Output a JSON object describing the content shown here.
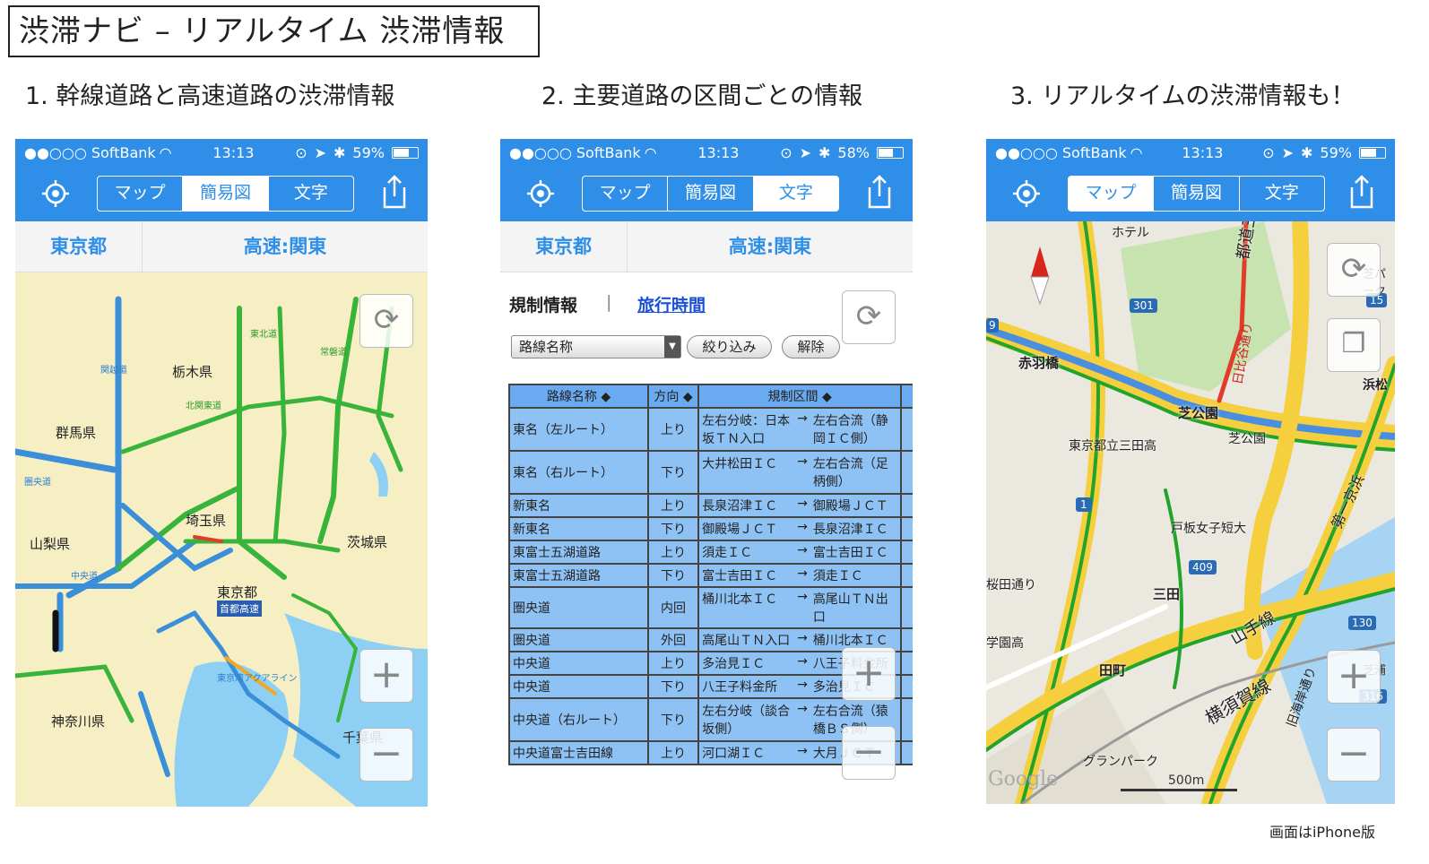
{
  "title": "渋滞ナビ – リアルタイム 渋滞情報",
  "captions": [
    "1. 幹線道路と高速道路の渋滞情報",
    "2. 主要道路の区間ごとの情報",
    "3. リアルタイムの渋滞情報も！"
  ],
  "footer": "画面はiPhone版",
  "colors": {
    "accent": "#2f8fe8",
    "table_cell": "#8fc2f4",
    "jam": "#e23b2b",
    "flow": "#22a42a",
    "slow": "#f5a623"
  },
  "phones": [
    {
      "carrier": "●●○○○ SoftBank",
      "time": "13:13",
      "battery": "59%",
      "selected_tab": "簡易図",
      "battery_level": 0.59
    },
    {
      "carrier": "●●○○○ SoftBank",
      "time": "13:13",
      "battery": "58%",
      "selected_tab": "文字",
      "battery_level": 0.58
    },
    {
      "carrier": "●●○○○ SoftBank",
      "time": "13:13",
      "battery": "59%",
      "selected_tab": "マップ",
      "battery_level": 0.59
    }
  ],
  "tabs": {
    "map": "マップ",
    "simple": "簡易図",
    "text": "文字"
  },
  "region": {
    "area": "東京都",
    "road": "高速:関東"
  },
  "simple_map": {
    "prefectures": [
      "栃木県",
      "群馬県",
      "埼玉県",
      "茨城県",
      "山梨県",
      "東京都",
      "神奈川県",
      "千葉県"
    ],
    "labels": [
      "首都高速",
      "東京湾アクアライン",
      "北関東道",
      "圏央道",
      "東北道",
      "常磐道",
      "中央道",
      "関越道"
    ]
  },
  "info": {
    "tab_regulation": "規制情報",
    "separator": "|",
    "tab_travel_time": "旅行時間",
    "select_value": "路線名称",
    "filter_button": "絞り込み",
    "clear_button": "解除"
  },
  "table": {
    "headers": [
      "路線名称 ◆",
      "方向 ◆",
      "規制区間 ◆"
    ],
    "rows": [
      {
        "road": "東名（左ルート）",
        "dir": "上り",
        "from": "左右分岐：日本坂ＴＮ入口",
        "to": "左右合流（静岡ＩＣ側）"
      },
      {
        "road": "東名（右ルート）",
        "dir": "下り",
        "from": "大井松田ＩＣ",
        "to": "左右合流（足柄側）"
      },
      {
        "road": "新東名",
        "dir": "上り",
        "from": "長泉沼津ＩＣ",
        "to": "御殿場ＪＣＴ"
      },
      {
        "road": "新東名",
        "dir": "下り",
        "from": "御殿場ＪＣＴ",
        "to": "長泉沼津ＩＣ"
      },
      {
        "road": "東富士五湖道路",
        "dir": "上り",
        "from": "須走ＩＣ",
        "to": "富士吉田ＩＣ"
      },
      {
        "road": "東富士五湖道路",
        "dir": "下り",
        "from": "富士吉田ＩＣ",
        "to": "須走ＩＣ"
      },
      {
        "road": "圏央道",
        "dir": "内回",
        "from": "桶川北本ＩＣ",
        "to": "高尾山ＴＮ出口"
      },
      {
        "road": "圏央道",
        "dir": "外回",
        "from": "高尾山ＴＮ入口",
        "to": "桶川北本ＩＣ"
      },
      {
        "road": "中央道",
        "dir": "上り",
        "from": "多治見ＩＣ",
        "to": "八王子料金所"
      },
      {
        "road": "中央道",
        "dir": "下り",
        "from": "八王子料金所",
        "to": "多治見ＩＣ"
      },
      {
        "road": "中央道（右ルート）",
        "dir": "下り",
        "from": "左右分岐（談合坂側）",
        "to": "左右合流（猿橋ＢＳ側）"
      },
      {
        "road": "中央道富士吉田線",
        "dir": "上り",
        "from": "河口湖ＩＣ",
        "to": "大月ＪＣＴ"
      }
    ]
  },
  "map3": {
    "places": [
      "ホテル",
      "赤羽橋",
      "芝公園",
      "芝公園",
      "東京都立三田高",
      "戸板女子短大",
      "三田",
      "田町",
      "学園高",
      "桜田通り",
      "山手線",
      "横須賀線",
      "第一京浜",
      "都道三田線",
      "日比谷通り",
      "旧海岸通り",
      "グランパーク",
      "浜松",
      "芝浦",
      "芝パーク"
    ],
    "route_numbers": [
      "301",
      "1",
      "409",
      "130",
      "316",
      "15",
      "9"
    ],
    "scale": "500m",
    "logo": "Google"
  }
}
